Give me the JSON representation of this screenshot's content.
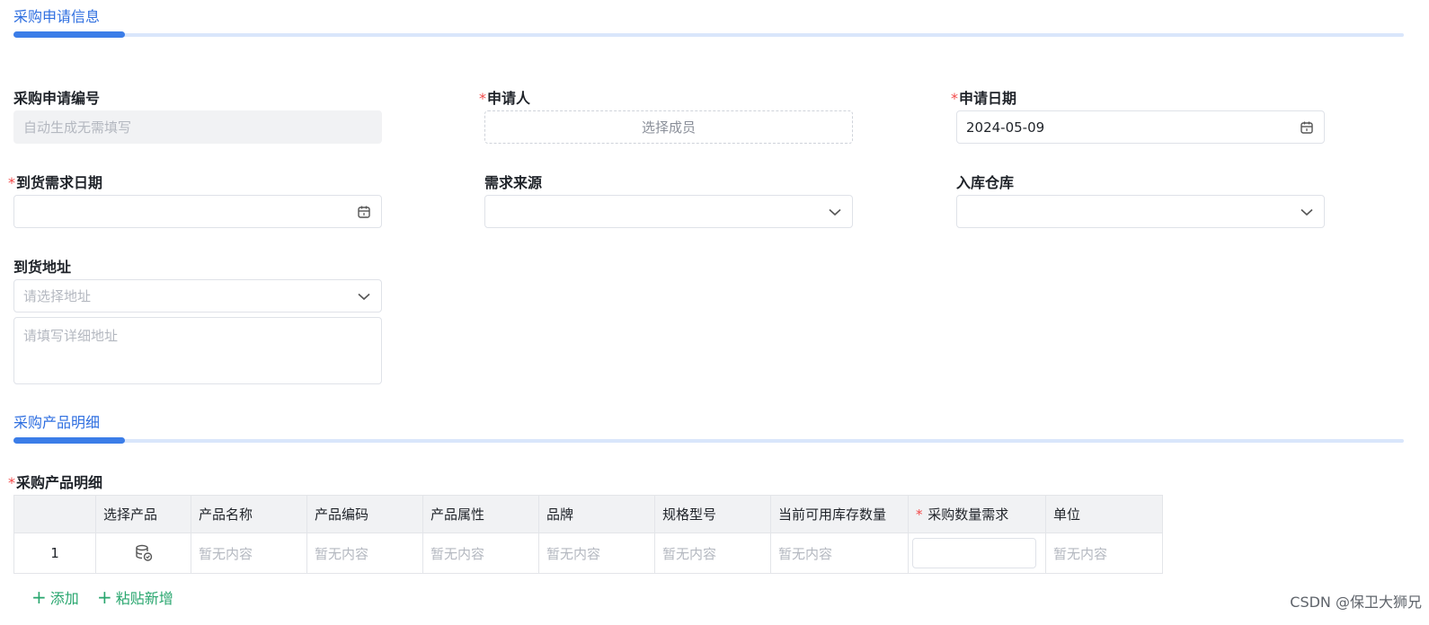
{
  "sections": {
    "request_info": "采购申请信息",
    "product_detail": "采购产品明细"
  },
  "form": {
    "request_no": {
      "label": "采购申请编号",
      "placeholder": "自动生成无需填写"
    },
    "applicant": {
      "label": "申请人",
      "required_mark": "*",
      "placeholder": "选择成员"
    },
    "apply_date": {
      "label": "申请日期",
      "required_mark": "*",
      "value": "2024-05-09",
      "icon": "calendar-icon"
    },
    "arrival_date": {
      "label": "到货需求日期",
      "required_mark": "*",
      "value": "",
      "icon": "calendar-icon"
    },
    "demand_source": {
      "label": "需求来源",
      "value": "",
      "icon": "chevron-down-icon"
    },
    "warehouse": {
      "label": "入库仓库",
      "value": "",
      "icon": "chevron-down-icon"
    },
    "address": {
      "label": "到货地址",
      "select_placeholder": "请选择地址",
      "detail_placeholder": "请填写详细地址"
    }
  },
  "product_table": {
    "label": "采购产品明细",
    "required_mark": "*",
    "columns": [
      "",
      "选择产品",
      "产品名称",
      "产品编码",
      "产品属性",
      "品牌",
      "规格型号",
      "当前可用库存数量",
      "采购数量需求",
      "单位"
    ],
    "qty_required_mark": "*",
    "rows": [
      {
        "index": "1",
        "select_icon": "database-select-icon",
        "name": "暂无内容",
        "code": "暂无内容",
        "attr": "暂无内容",
        "brand": "暂无内容",
        "spec": "暂无内容",
        "stock": "暂无内容",
        "qty": "",
        "unit": "暂无内容"
      }
    ]
  },
  "actions": {
    "add": "添加",
    "paste_add": "粘贴新增"
  },
  "watermark": "CSDN @保卫大狮兄",
  "colors": {
    "accent": "#3b7de8",
    "required": "#f24949",
    "link": "#28a66e"
  }
}
